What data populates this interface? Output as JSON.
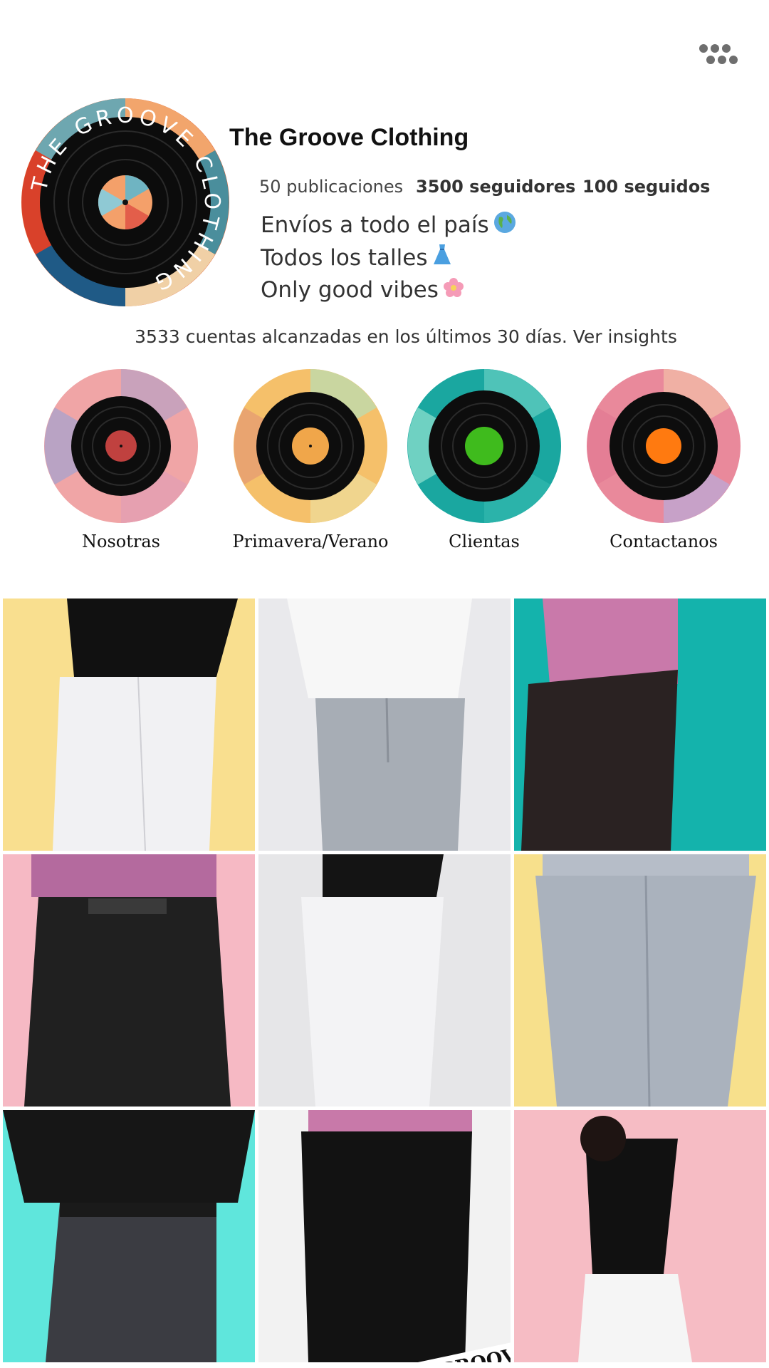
{
  "profile": {
    "name": "The Groove Clothing",
    "avatar_ring_text": "THE GROOVE CLOTHING",
    "stats": {
      "posts": "50 publicaciones",
      "followers": "3500 seguidores",
      "following": "100 seguidos"
    },
    "bio": [
      "Envíos a todo el país",
      "Todos los talles",
      "Only good vibes"
    ],
    "reach": "3533 cuentas alcanzadas en los últimos 30 días. Ver insights"
  },
  "menu": {
    "icon": "more-dots-icon"
  },
  "highlights": [
    {
      "label": "Nosotras",
      "label_color": "#c0413f"
    },
    {
      "label": "Primavera/Verano",
      "label_color": "#f0a64a"
    },
    {
      "label": "Clientas",
      "label_color": "#3fbb1d"
    },
    {
      "label": "Contactanos",
      "label_color": "#ff7a10"
    }
  ],
  "posts": [
    {
      "bg": "#f9df8f",
      "top": "#111111",
      "pants": "#f1f1f3"
    },
    {
      "bg": "#e9e9ec",
      "top": "#f7f7f7",
      "pants": "#a7adb5"
    },
    {
      "bg": "#14b3ac",
      "top": "#c979aa",
      "pants": "#2a2222"
    },
    {
      "bg": "#f6b9c4",
      "top": "#b46a9e",
      "pants": "#202020"
    },
    {
      "bg": "#e6e6e8",
      "top": "#141414",
      "pants": "#f3f3f5"
    },
    {
      "bg": "#f7e08c",
      "top": "#b6bdc8",
      "pants": "#aab2bd"
    },
    {
      "bg": "#5fe6dc",
      "top": "#161616",
      "pants": "#3b3c42"
    },
    {
      "bg": "#f2f2f2",
      "top": "#c879a9",
      "pants": "#121212"
    },
    {
      "bg": "#f6bcc4",
      "top": "#111111",
      "pants": "#f5f5f5"
    }
  ],
  "watermark": "THE GROOVE CLOTHING"
}
